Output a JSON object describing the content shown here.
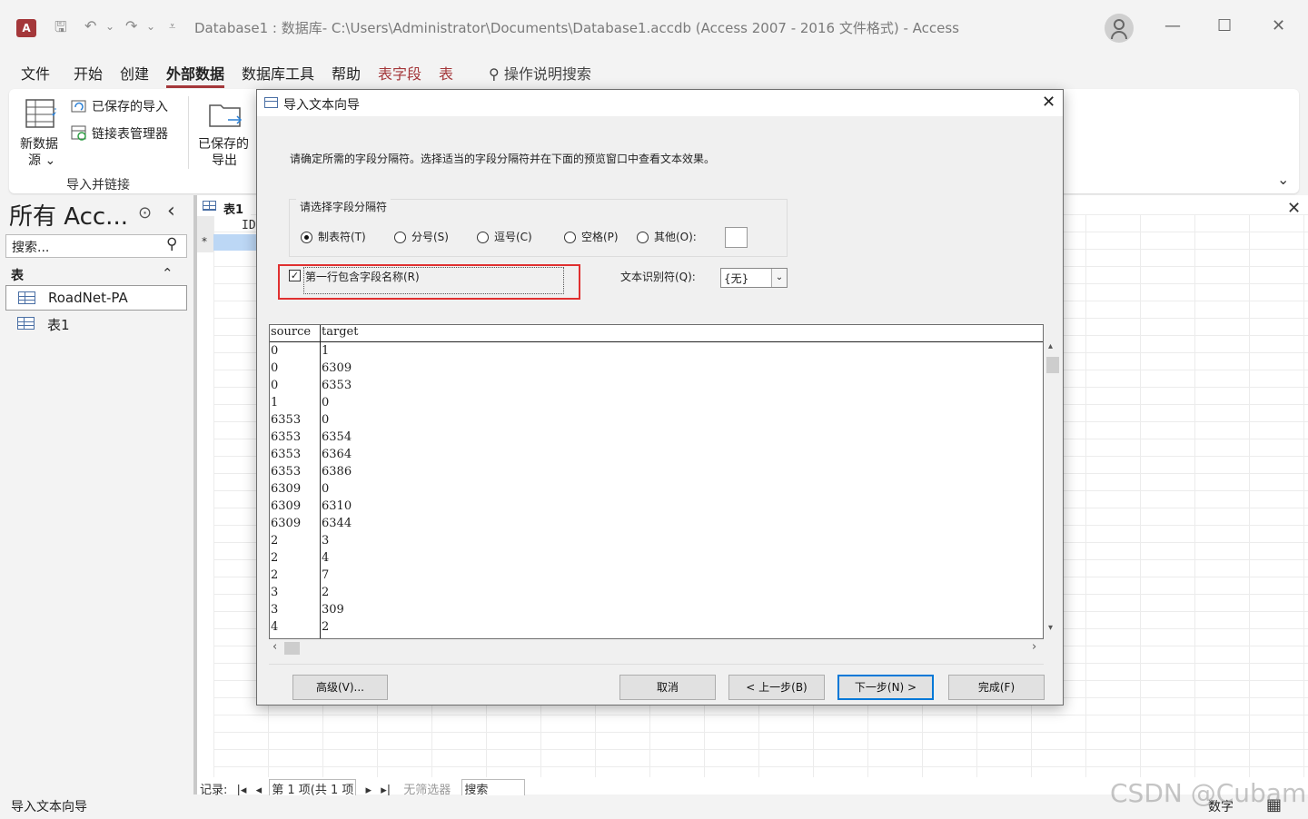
{
  "window": {
    "title": "Database1 : 数据库- C:\\Users\\Administrator\\Documents\\Database1.accdb (Access 2007 - 2016 文件格式)  -  Access",
    "app_logo": "A",
    "controls": {
      "minimize": "—",
      "maximize": "☐",
      "close": "✕"
    }
  },
  "quick_access": {
    "save": "🖫",
    "undo": "↶",
    "undo_drop": "⌄",
    "redo": "↷",
    "redo_drop": "⌄",
    "customize": "⩡"
  },
  "ribbon_tabs": [
    {
      "label": "文件"
    },
    {
      "label": "开始"
    },
    {
      "label": "创建"
    },
    {
      "label": "外部数据"
    },
    {
      "label": "数据库工具"
    },
    {
      "label": "帮助"
    },
    {
      "label": "表字段"
    },
    {
      "label": "表"
    }
  ],
  "tell_me": {
    "icon": "⚲",
    "label": "操作说明搜索"
  },
  "ribbon": {
    "new_source_line1": "新数据",
    "new_source_line2": "源 ⌄",
    "saved_imports": "已保存的导入",
    "linked_table_manager": "链接表管理器",
    "saved_exports_line1": "已保存的",
    "saved_exports_line2": "导出",
    "group_label": "导入并链接",
    "collapse": "⌄"
  },
  "nav": {
    "title": "所有 Acc...",
    "menu_glyph": "⊙",
    "collapse_glyph": "‹",
    "search_placeholder": "搜索...",
    "search_glyph": "⚲",
    "section": "表",
    "section_glyph": "⌃",
    "items": [
      {
        "label": "RoadNet-PA"
      },
      {
        "label": "表1"
      }
    ]
  },
  "doc": {
    "tab": "表1",
    "column": "ID",
    "new_row": "*",
    "close": "✕",
    "record_label": "记录:",
    "record_first": "|◂",
    "record_prev": "◂",
    "record_position": "第 1 项(共 1 项",
    "record_next": "▸",
    "record_last": "▸|",
    "filter_label": "无筛选器",
    "search": "搜索"
  },
  "status": {
    "left": "导入文本向导",
    "mode": "数字",
    "view_icon": "▦"
  },
  "watermark": "CSDN @Cubaman",
  "dialog": {
    "title": "导入文本向导",
    "close": "✕",
    "instruction": "请确定所需的字段分隔符。选择适当的字段分隔符并在下面的预览窗口中查看文本效果。",
    "group_label": "请选择字段分隔符",
    "delimiters": [
      {
        "label": "制表符(T)",
        "selected": true
      },
      {
        "label": "分号(S)",
        "selected": false
      },
      {
        "label": "逗号(C)",
        "selected": false
      },
      {
        "label": "空格(P)",
        "selected": false
      },
      {
        "label": "其他(O):",
        "selected": false
      }
    ],
    "first_row_names": {
      "label": "第一行包含字段名称(R)",
      "checked": true,
      "mark": "✓"
    },
    "qualifier_label": "文本识别符(Q):",
    "qualifier_value": "{无}",
    "qualifier_arrow": "⌄",
    "preview": {
      "headers": [
        "source",
        "target"
      ],
      "rows": [
        [
          "0",
          "1"
        ],
        [
          "0",
          "6309"
        ],
        [
          "0",
          "6353"
        ],
        [
          "1",
          "0"
        ],
        [
          "6353",
          "0"
        ],
        [
          "6353",
          "6354"
        ],
        [
          "6353",
          "6364"
        ],
        [
          "6353",
          "6386"
        ],
        [
          "6309",
          "0"
        ],
        [
          "6309",
          "6310"
        ],
        [
          "6309",
          "6344"
        ],
        [
          "2",
          "3"
        ],
        [
          "2",
          "4"
        ],
        [
          "2",
          "7"
        ],
        [
          "3",
          "2"
        ],
        [
          "3",
          "309"
        ],
        [
          "4",
          "2"
        ]
      ]
    },
    "scroll": {
      "up": "▴",
      "down": "▾",
      "left": "‹",
      "right": "›"
    },
    "buttons": {
      "advanced": "高级(V)...",
      "cancel": "取消",
      "back": "< 上一步(B)",
      "next": "下一步(N) >",
      "finish": "完成(F)"
    }
  }
}
